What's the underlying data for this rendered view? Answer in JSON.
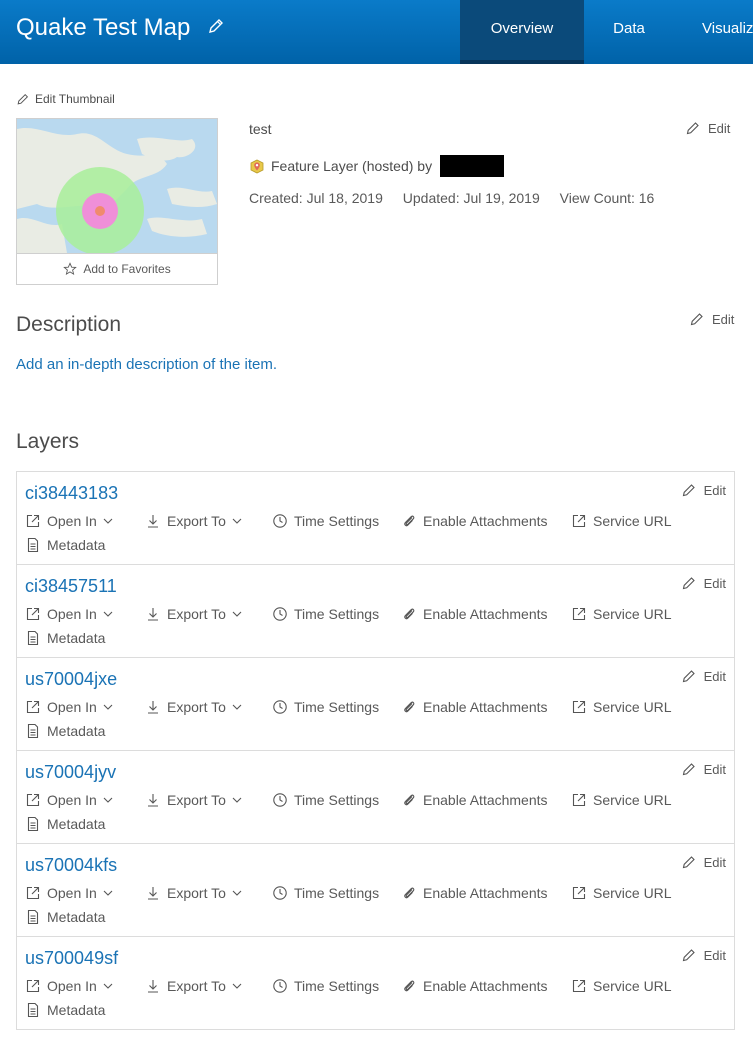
{
  "header": {
    "title": "Quake Test Map",
    "tabs": [
      {
        "label": "Overview",
        "active": true
      },
      {
        "label": "Data",
        "active": false
      },
      {
        "label": "Visualiz",
        "active": false
      }
    ]
  },
  "thumbnail": {
    "edit_label": "Edit Thumbnail",
    "favorites_label": "Add to Favorites"
  },
  "item": {
    "name": "test",
    "type_label": "Feature Layer (hosted) by",
    "created": "Created: Jul 18, 2019",
    "updated": "Updated: Jul 19, 2019",
    "view_count": "View Count: 16",
    "edit_label": "Edit"
  },
  "description": {
    "heading": "Description",
    "edit_label": "Edit",
    "placeholder_link": "Add an in-depth description of the item."
  },
  "layers": {
    "heading": "Layers",
    "actions": {
      "open_in": "Open In",
      "export_to": "Export To",
      "time_settings": "Time Settings",
      "enable_attachments": "Enable Attachments",
      "service_url": "Service URL",
      "metadata": "Metadata",
      "edit": "Edit"
    },
    "items": [
      {
        "name": "ci38443183"
      },
      {
        "name": "ci38457511"
      },
      {
        "name": "us70004jxe"
      },
      {
        "name": "us70004jyv"
      },
      {
        "name": "us70004kfs"
      },
      {
        "name": "us700049sf"
      }
    ]
  },
  "colors": {
    "header_blue": "#0a7bc9",
    "active_tab": "#0b4a7a",
    "link_blue": "#1a73b5"
  }
}
